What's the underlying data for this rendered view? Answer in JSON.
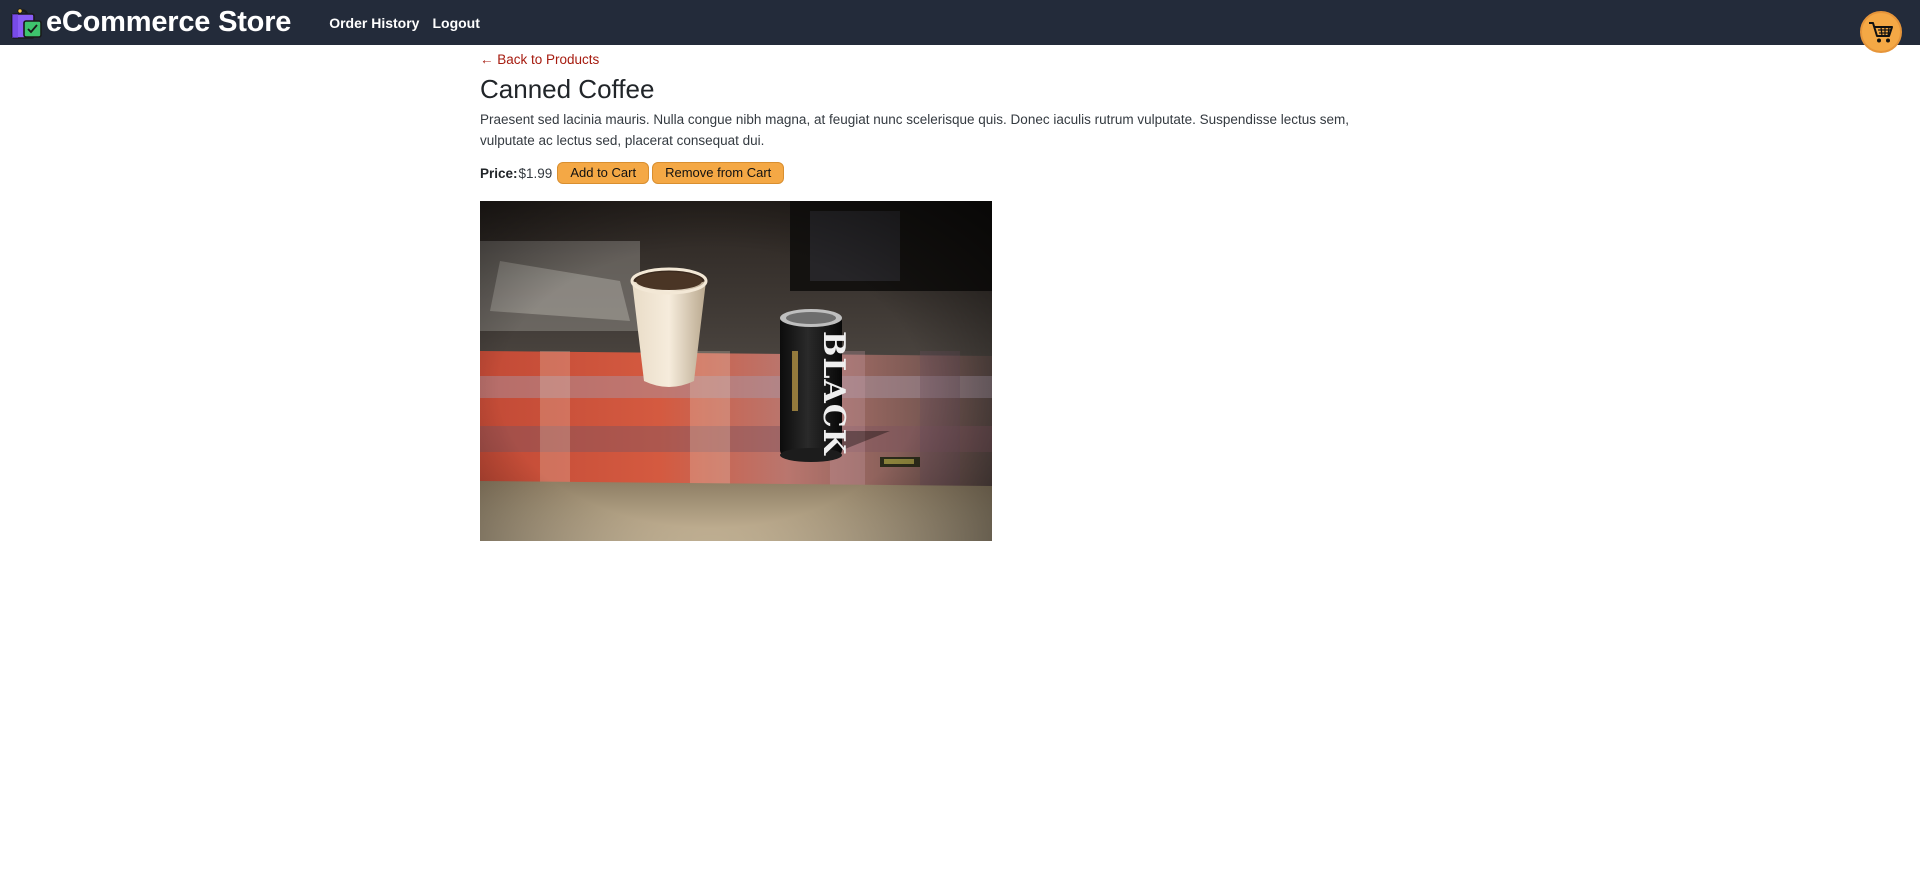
{
  "header": {
    "brand_name": "eCommerce Store",
    "brand_icon": "shopping-bag-icon",
    "nav_links": [
      {
        "label": "Order History"
      },
      {
        "label": "Logout"
      }
    ],
    "cart_icon": "shopping-cart-icon",
    "background_color": "#232b3a"
  },
  "product": {
    "back_link": "← Back to Products",
    "title": "Canned Coffee",
    "description": "Praesent sed lacinia mauris. Nulla congue nibh magna, at feugiat nunc scelerisque quis. Donec iaculis rutrum vulputate. Suspendisse lectus sem, vulputate ac lectus sed, placerat consequat dui.",
    "price_label": "Price:",
    "price": "$1.99",
    "add_to_cart_label": "Add to Cart",
    "remove_from_cart_label": "Remove from Cart",
    "image_subject": "canned-coffee-photo"
  },
  "colors": {
    "accent_button": "#f4a845",
    "link": "#a61b0f"
  }
}
